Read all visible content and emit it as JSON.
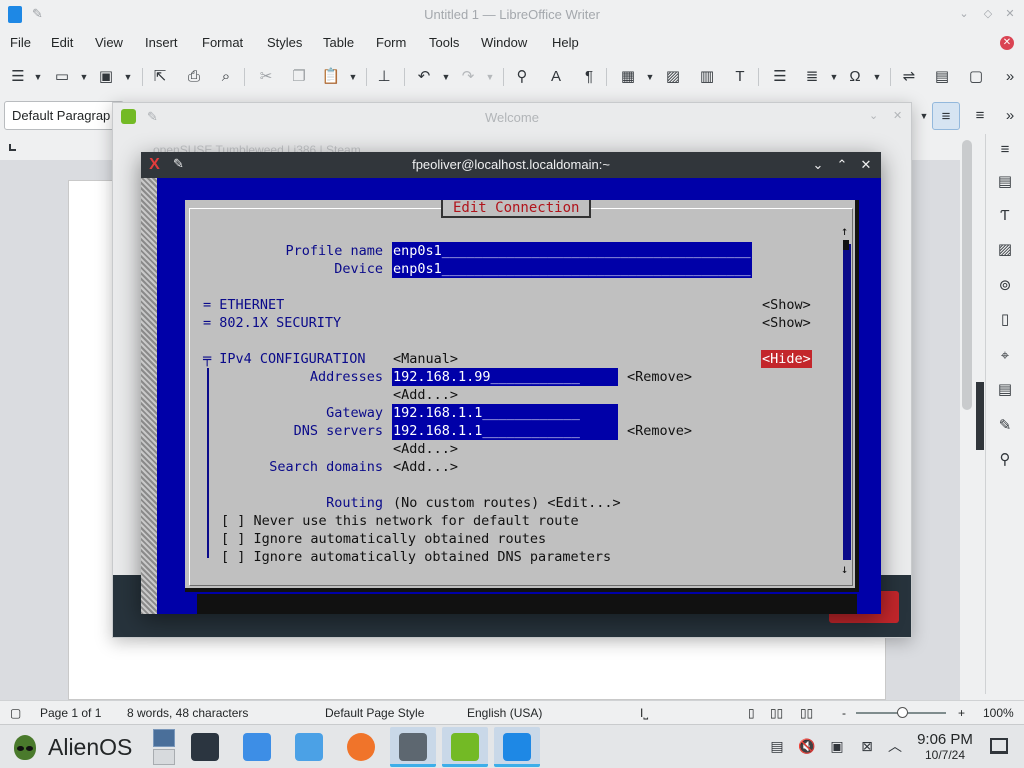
{
  "writer": {
    "title": "Untitled 1 — LibreOffice Writer",
    "menu": [
      "File",
      "Edit",
      "View",
      "Insert",
      "Format",
      "Styles",
      "Table",
      "Form",
      "Tools",
      "Window",
      "Help"
    ],
    "paragraph_style": "Default Paragrap",
    "status": {
      "page": "Page 1 of 1",
      "words": "8 words, 48 characters",
      "page_style": "Default Page Style",
      "language": "English (USA)",
      "zoom": "100%",
      "zoom_minus": "-",
      "zoom_plus": "+"
    }
  },
  "welcome": {
    "title": "Welcome",
    "tabs_text": "openSUSE Tumbleweed   |   i386   |   Steam"
  },
  "terminal": {
    "title": "fpeoliver@localhost.localdomain:~",
    "dialog": {
      "title": "Edit Connection",
      "profile_name_label": "Profile name",
      "profile_name_value": "enp0s1______________________________________",
      "device_label": "Device",
      "device_value": "enp0s1______________________________________",
      "ethernet": "= ETHERNET",
      "ethernet_toggle": "<Show>",
      "security": "= 802.1X SECURITY",
      "security_toggle": "<Show>",
      "ipv4": "╤ IPv4 CONFIGURATION",
      "ipv4_method": "<Manual>",
      "ipv4_toggle": "<Hide>",
      "addresses_label": "Addresses",
      "address_value": "192.168.1.99___________",
      "remove": "<Remove>",
      "add": "<Add...>",
      "gateway_label": "Gateway",
      "gateway_value": "192.168.1.1____________",
      "dns_label": "DNS servers",
      "dns_value": "192.168.1.1____________",
      "search_label": "Search domains",
      "routing_label": "Routing",
      "routing_value": "(No custom routes) <Edit...>",
      "opt1": "[ ] Never use this network for default route",
      "opt2": "[ ] Ignore automatically obtained routes",
      "opt3": "[ ] Ignore automatically obtained DNS parameters",
      "scroll_up": "↑",
      "scroll_down": "↓"
    }
  },
  "taskbar": {
    "os_name": "AlienOS",
    "time": "9:06 PM",
    "date": "10/7/24"
  },
  "colors": {
    "tui_blue": "#0000a8",
    "tui_gray": "#c0c0c0",
    "tui_red": "#c3262b",
    "accent": "#3daee9"
  }
}
